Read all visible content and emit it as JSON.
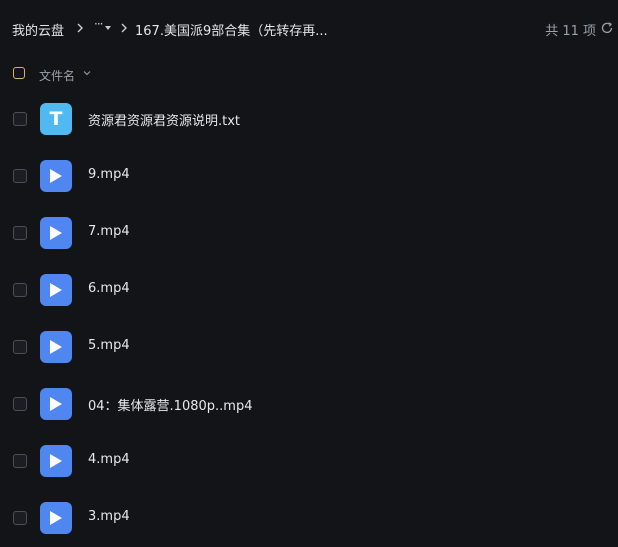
{
  "breadcrumb": {
    "root": "我的云盘",
    "more": "···",
    "current": "167.美国派9部合集（先转存再..."
  },
  "item_count": "共 11 项",
  "header": {
    "name_column": "文件名"
  },
  "files": [
    {
      "name": "资源君资源君资源说明.txt",
      "type": "txt",
      "icon_letter": "T"
    },
    {
      "name": "9.mp4",
      "type": "video"
    },
    {
      "name": "7.mp4",
      "type": "video"
    },
    {
      "name": "6.mp4",
      "type": "video"
    },
    {
      "name": "5.mp4",
      "type": "video"
    },
    {
      "name": "04：集体露营.1080p..mp4",
      "type": "video"
    },
    {
      "name": "4.mp4",
      "type": "video"
    },
    {
      "name": "3.mp4",
      "type": "video"
    }
  ],
  "colors": {
    "background": "#121417",
    "txt_icon": "#4fb9f2",
    "video_icon": "#4f86f0",
    "select_all_border": "#d9b25a"
  },
  "icons": {
    "refresh": "refresh-icon",
    "chevron": "chevron-right-icon",
    "sort": "chevron-down-icon",
    "video": "play-icon",
    "text": "txt-file-icon"
  }
}
